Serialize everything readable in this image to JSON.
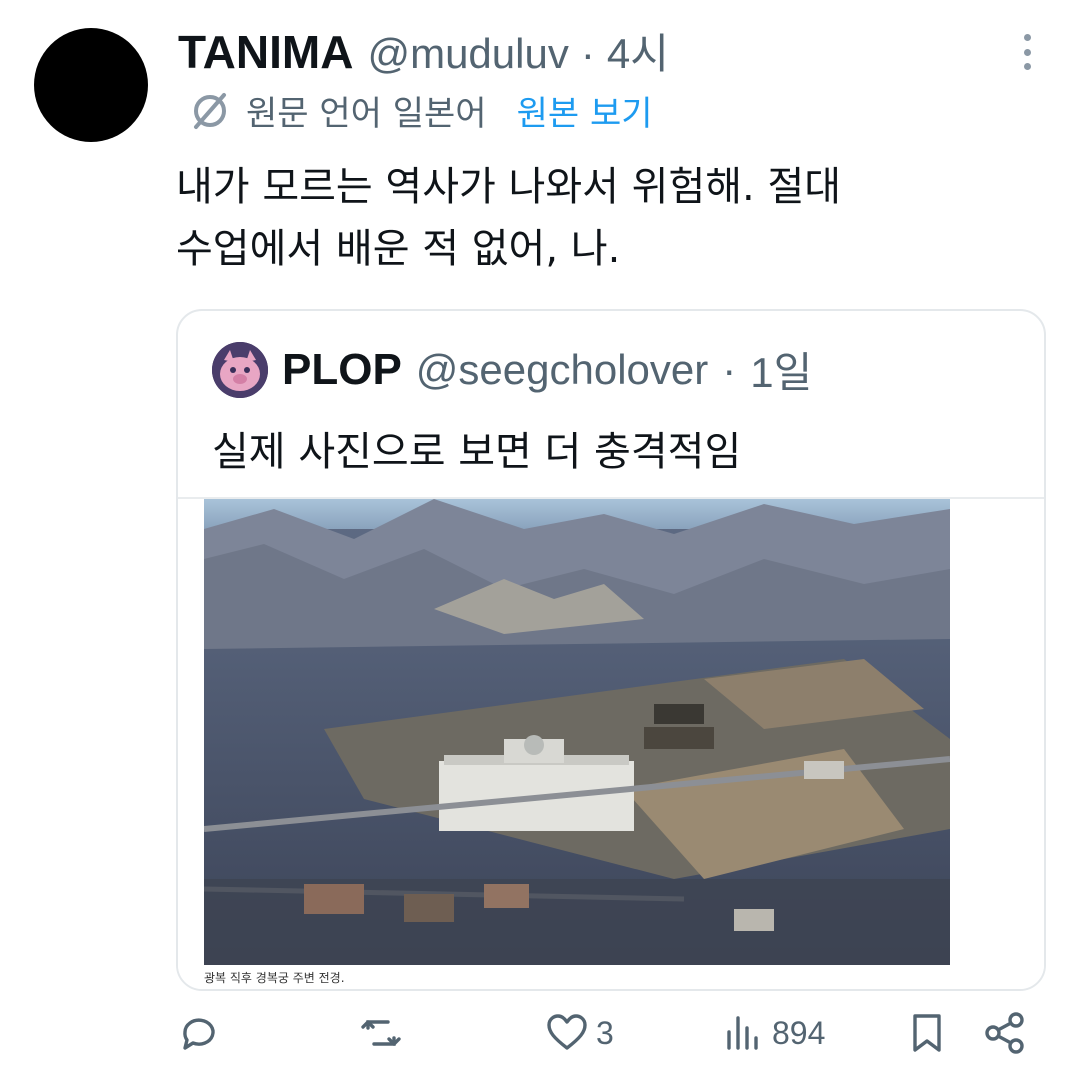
{
  "author": {
    "display_name": "TANIMA",
    "handle": "@muduluv",
    "separator": "·",
    "time": "4시"
  },
  "translation": {
    "original_language": "원문 언어 일본어",
    "show_original_label": "원본 보기"
  },
  "tweet": {
    "text": "내가 모르는 역사가 나와서 위험해. 절대\n수업에서 배운 적 없어, 나."
  },
  "quote": {
    "display_name": "PLOP",
    "handle": "@seegcholover",
    "separator": "·",
    "time": "1일",
    "text": "실제 사진으로 보면 더 충격적임",
    "photo_caption": "광복 직후 경복궁 주변 전경."
  },
  "actions": {
    "reply_count": "",
    "retweet_count": "",
    "like_count": "3",
    "views_count": "894"
  },
  "icons": {
    "translate": "translate-icon",
    "more": "more-options-icon",
    "reply": "reply-icon",
    "retweet": "retweet-icon",
    "like": "heart-icon",
    "views": "views-icon",
    "bookmark": "bookmark-icon",
    "share": "share-icon"
  },
  "colors": {
    "accent": "#1d9bf0",
    "secondary_text": "#536471",
    "primary_text": "#0f1419"
  }
}
